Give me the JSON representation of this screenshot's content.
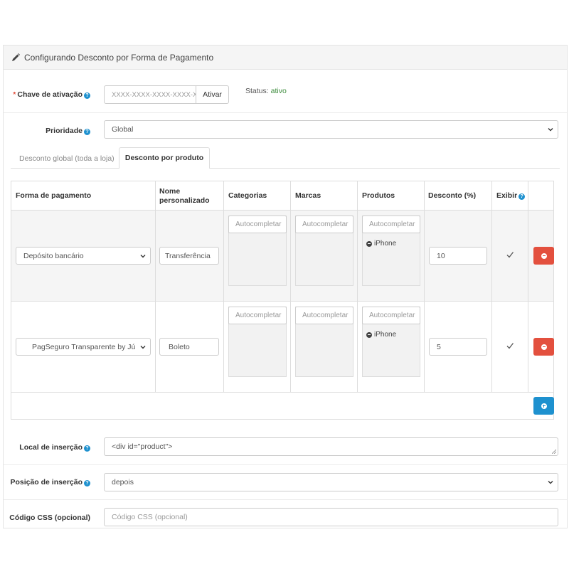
{
  "panel": {
    "title": "Configurando Desconto por Forma de Pagamento",
    "icon": "pencil-icon"
  },
  "activation": {
    "label": "Chave de ativação",
    "placeholder": "XXXX-XXXX-XXXX-XXXX-XX",
    "button": "Ativar",
    "status_label": "Status:",
    "status_value": "ativo",
    "status_color": "#3c8b3c"
  },
  "priority": {
    "label": "Prioridade",
    "value": "Global"
  },
  "tabs": [
    {
      "label": "Desconto global (toda a loja)",
      "active": false
    },
    {
      "label": "Desconto por produto",
      "active": true
    }
  ],
  "table": {
    "headers": {
      "payment": "Forma de pagamento",
      "name_line1": "Nome",
      "name_line2": "personalizado",
      "categories": "Categorias",
      "brands": "Marcas",
      "products": "Produtos",
      "discount": "Desconto (%)",
      "show": "Exibir"
    },
    "autocomplete_placeholder": "Autocompletar",
    "rows": [
      {
        "payment": "Depósito bancário",
        "name": "Transferência",
        "product_tag": "iPhone",
        "discount": "10",
        "show": true
      },
      {
        "payment": "PagSeguro Transparente by Júlio",
        "name": "Boleto",
        "product_tag": "iPhone",
        "discount": "5",
        "show": true
      }
    ]
  },
  "insertion_place": {
    "label": "Local de inserção",
    "value": "<div id=\"product\">"
  },
  "insertion_position": {
    "label": "Posição de inserção",
    "value": "depois"
  },
  "css_code": {
    "label": "Código CSS (opcional)",
    "placeholder": "Código CSS (opcional)"
  },
  "colors": {
    "accent_blue": "#1e91cf",
    "danger_red": "#e3503e",
    "required_red": "#e3503e"
  }
}
